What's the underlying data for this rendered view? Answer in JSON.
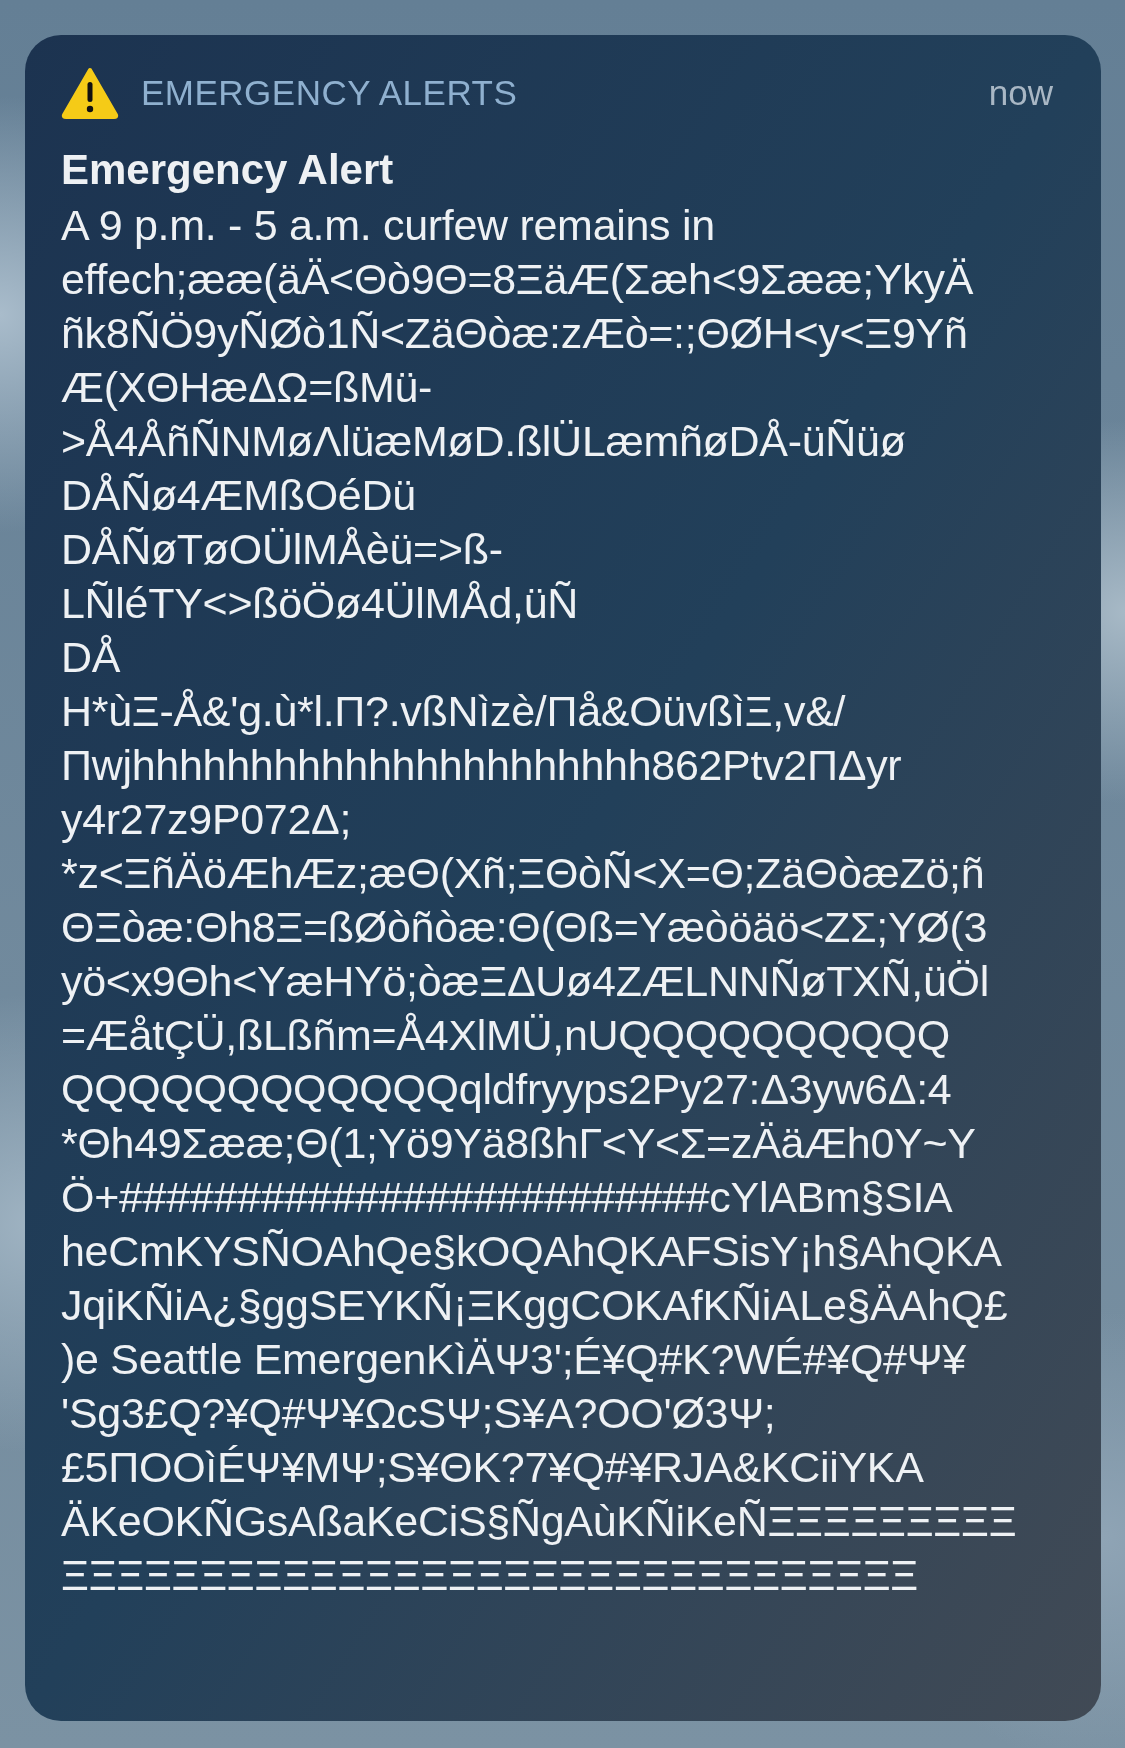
{
  "notification": {
    "app_name": "EMERGENCY ALERTS",
    "time": "now",
    "title": "Emergency Alert",
    "body": "A 9 p.m. - 5 a.m. curfew remains in\neffech;ææ(äÄ<Θò9Θ=8ΞäÆ(Σæh<9Σææ;YkyÄ\nñk8ÑÖ9yÑØò1Ñ<ZäΘòæ:zÆò=:;ΘØH<y<Ξ9Yñ\nÆ(XΘHæΔΩ=ßMü-\n>Å4ÅñÑNMøΛlüæMøD.ßlÜLæmñøDÅ-üÑüø\nDÅÑø4ÆMßOéDü\nDÅÑøTøOÜlMÅèü=>ß-\nLÑléTY<>ßöÖø4ÜlMÅd,üÑ\nDÅ\nH*ùΞ-Å&'g.ù*l.Π?.vßNìzè/Πå&OüvßìΞ,v&/\nΠwjhhhhhhhhhhhhhhhhhhhhhh862Ptv2ΠΔyr\ny4r27z9P072Δ;\n*z<ΞñÄöÆhÆz;æΘ(Xñ;ΞΘòÑ<X=Θ;ZäΘòæZö;ñ\nΘΞòæ:Θh8Ξ=ßØòñòæ:Θ(Θß=Yæòöäö<ZΣ;YØ(3\nyö<x9Θh<YæHYö;òæΞΔUø4ZÆLNNÑøTXÑ,üÖl\n=ÆåtÇÜ,ßLßñm=Å4XlMÜ,nUQQQQQQQQQQ\nQQQQQQQQQQQQqldfryyps2Py27:Δ3yw6Δ:4\n*Θh49Σææ;Θ(1;Yö9Yä8ßhΓ<Y<Σ=zÄäÆh0Y~Y\nÖ+#########################cYlABm§SIA\nheCmKYSÑOAhQe§kOQAhQKAFSisY¡h§AhQKA\nJqiKÑiA¿§ggSEYKÑ¡ΞKggCOKAfKÑiALe§ÄAhQ£\n)e Seattle EmergenKìÄΨ3';É¥Q#K?WÉ#¥Q#Ψ¥\n'Sg3£Q?¥Q#Ψ¥ΩcSΨ;S¥A?OO'Ø3Ψ;\n£5ΠOOìÉΨ¥MΨ;S¥ΘK?7¥Q#¥RJA&KCiiYKA\nÄKeOKÑGsAßaKeCiS§ÑgAùKÑiKeÑΞΞΞΞΞΞΞΞΞ\nΞΞΞΞΞΞΞΞΞΞΞΞΞΞΞΞΞΞΞΞΞΞΞΞΞΞΞΞΞΞΞ"
  }
}
